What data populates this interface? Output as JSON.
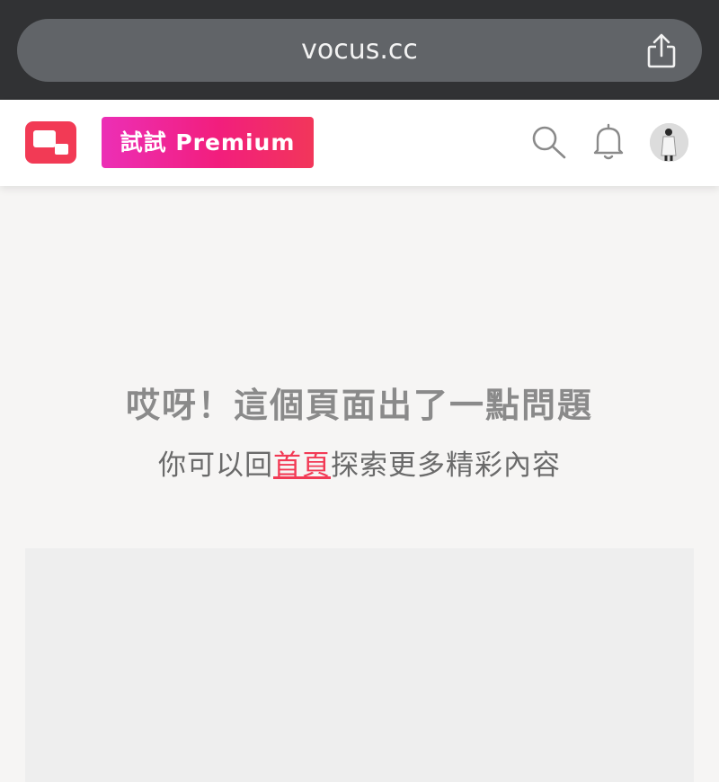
{
  "browser": {
    "url": "vocus.cc",
    "share_icon": "share-icon"
  },
  "header": {
    "logo_icon": "vocus-logo-icon",
    "premium_label": "試試 Premium",
    "search_icon": "search-icon",
    "bell_icon": "bell-icon",
    "avatar_icon": "user-avatar"
  },
  "error": {
    "title": "哎呀！這個頁面出了一點問題",
    "message_prefix": "你可以回",
    "home_link": "首頁",
    "message_suffix": "探索更多精彩內容"
  },
  "colors": {
    "brand": "#f23a55",
    "premium_gradient_start": "#ec2fb6",
    "premium_gradient_end": "#f2365a",
    "page_background": "#f6f5f4"
  }
}
